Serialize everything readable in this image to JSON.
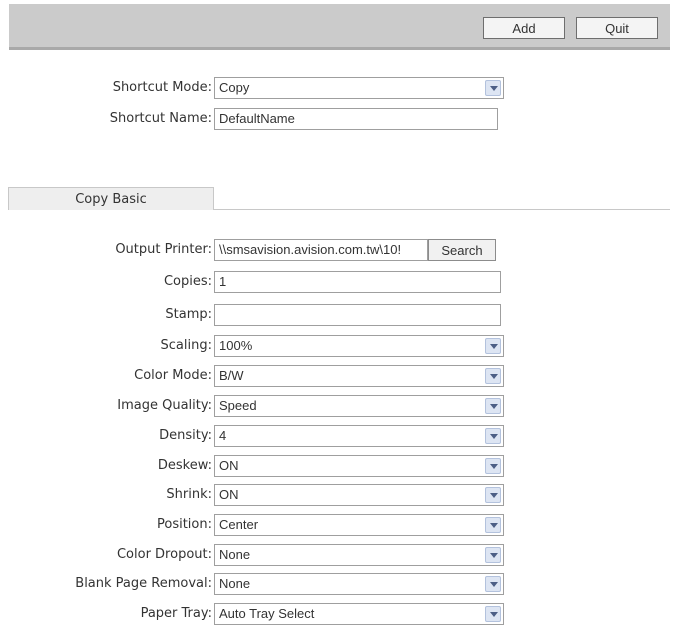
{
  "toolbar": {
    "add_label": "Add",
    "quit_label": "Quit"
  },
  "shortcut": {
    "mode_label": "Shortcut Mode:",
    "mode_value": "Copy",
    "name_label": "Shortcut Name:",
    "name_value": "DefaultName"
  },
  "tab": {
    "label": "Copy Basic"
  },
  "form": {
    "output_printer": {
      "label": "Output Printer:",
      "value": "\\\\smsavision.avision.com.tw\\10!",
      "search_label": "Search"
    },
    "copies": {
      "label": "Copies:",
      "value": "1"
    },
    "stamp": {
      "label": "Stamp:",
      "value": ""
    },
    "scaling": {
      "label": "Scaling:",
      "value": "100%"
    },
    "color_mode": {
      "label": "Color Mode:",
      "value": "B/W"
    },
    "image_quality": {
      "label": "Image Quality:",
      "value": "Speed"
    },
    "density": {
      "label": "Density:",
      "value": "4"
    },
    "deskew": {
      "label": "Deskew:",
      "value": "ON"
    },
    "shrink": {
      "label": "Shrink:",
      "value": "ON"
    },
    "position": {
      "label": "Position:",
      "value": "Center"
    },
    "color_dropout": {
      "label": "Color Dropout:",
      "value": "None"
    },
    "blank_page_removal": {
      "label": "Blank Page Removal:",
      "value": "None"
    },
    "paper_tray": {
      "label": "Paper Tray:",
      "value": "Auto Tray Select"
    }
  }
}
